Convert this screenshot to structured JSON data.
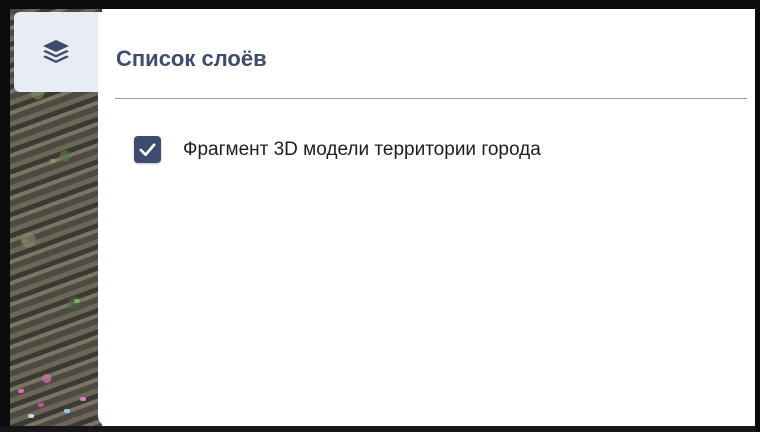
{
  "panel": {
    "title": "Список слоёв",
    "toggle_icon": "layers-icon"
  },
  "layers": [
    {
      "label": "Фрагмент 3D модели территории города",
      "checked": true
    }
  ],
  "colors": {
    "accent": "#3d4b6e",
    "toggle_bg": "#e8edf3",
    "divider": "#9a9a9a"
  }
}
